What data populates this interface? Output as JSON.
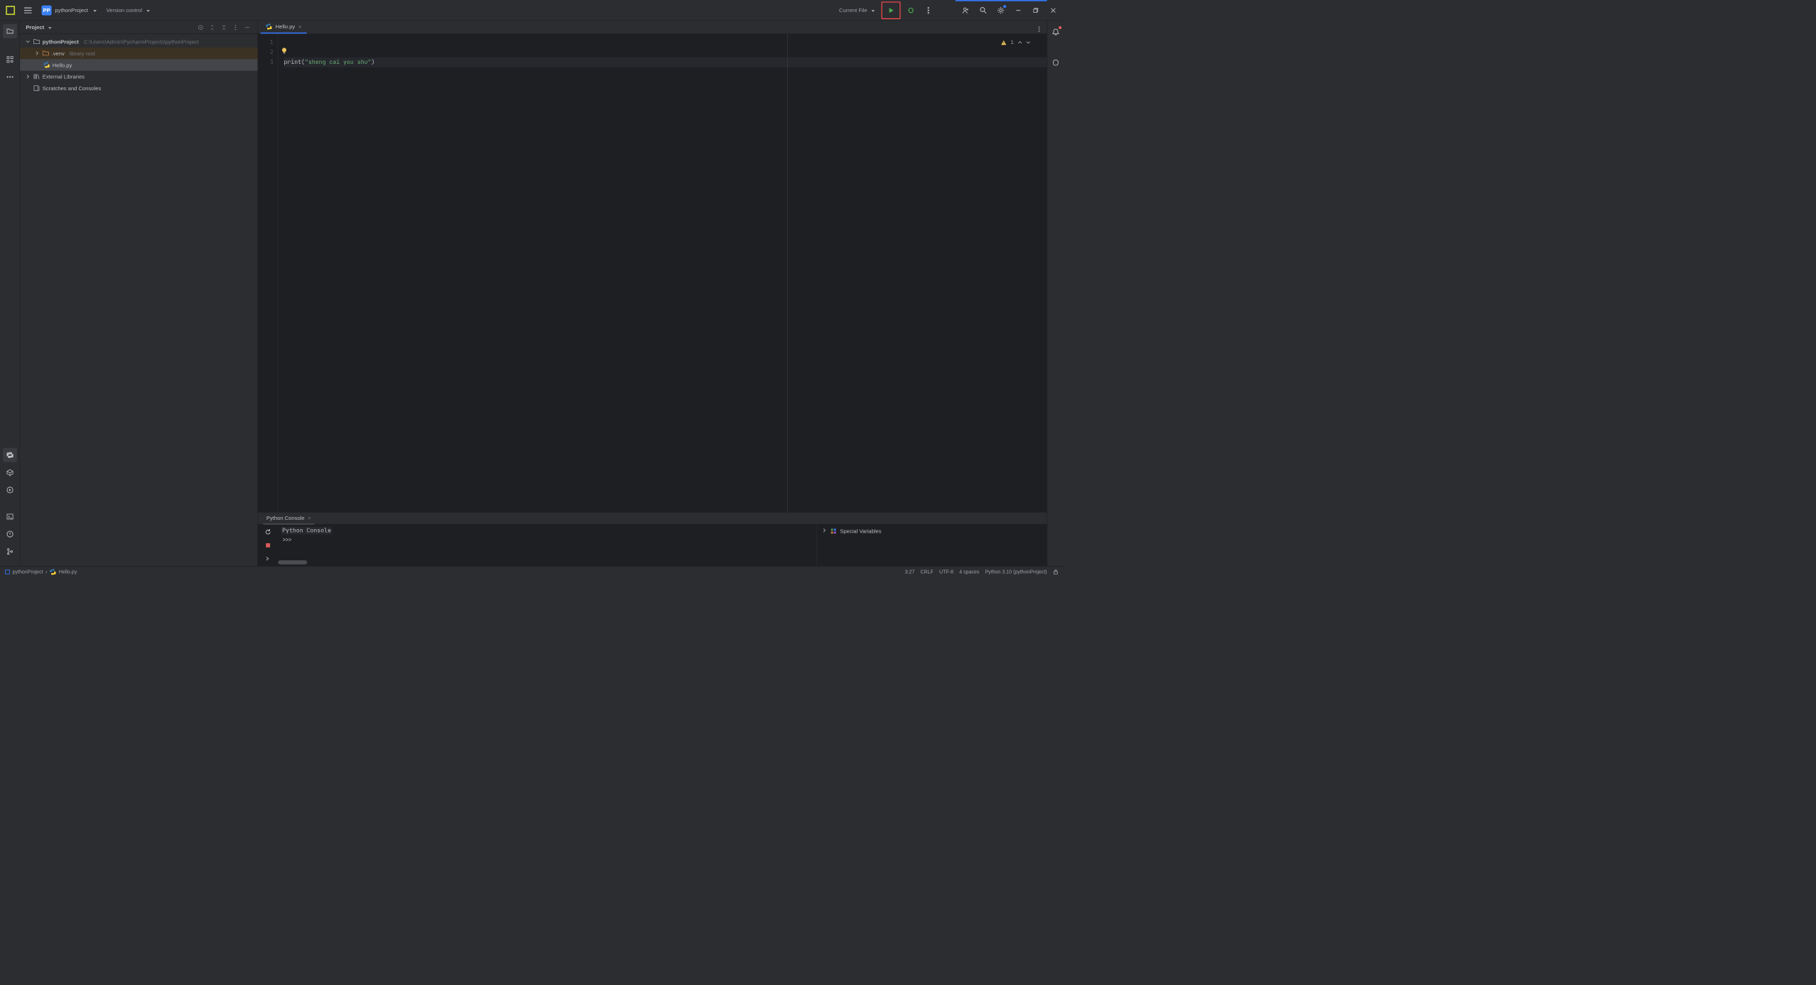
{
  "titlebar": {
    "project_badge": "PP",
    "project_name": "pythonProject",
    "version_control": "Version control",
    "run_config": "Current File"
  },
  "sidebar": {
    "title": "Project",
    "tree": {
      "root_name": "pythonProject",
      "root_path": "C:\\Users\\Admin\\PycharmProjects\\pythonProject",
      "venv_name": ".venv",
      "venv_note": "library root",
      "file0": "Hello.py",
      "external": "External Libraries",
      "scratches": "Scratches and Consoles"
    }
  },
  "editor": {
    "tab0_name": "Hello.py",
    "gutter": {
      "l1": "1",
      "l2": "2",
      "l3": "3"
    },
    "code": {
      "fn": "print",
      "open": "(",
      "str": "\"sheng cai you shu\"",
      "close": ")"
    },
    "inspections": {
      "warn_count": "1"
    }
  },
  "console": {
    "tab_label": "Python Console",
    "banner": "Python Console",
    "prompt": ">>> ",
    "vars_label": "Special Variables"
  },
  "status": {
    "crumb_project": "pythonProject",
    "crumb_file": "Hello.py",
    "caret": "3:27",
    "line_sep": "CRLF",
    "encoding": "UTF-8",
    "indent": "4 spaces",
    "interpreter": "Python 3.10 (pythonProject)"
  }
}
